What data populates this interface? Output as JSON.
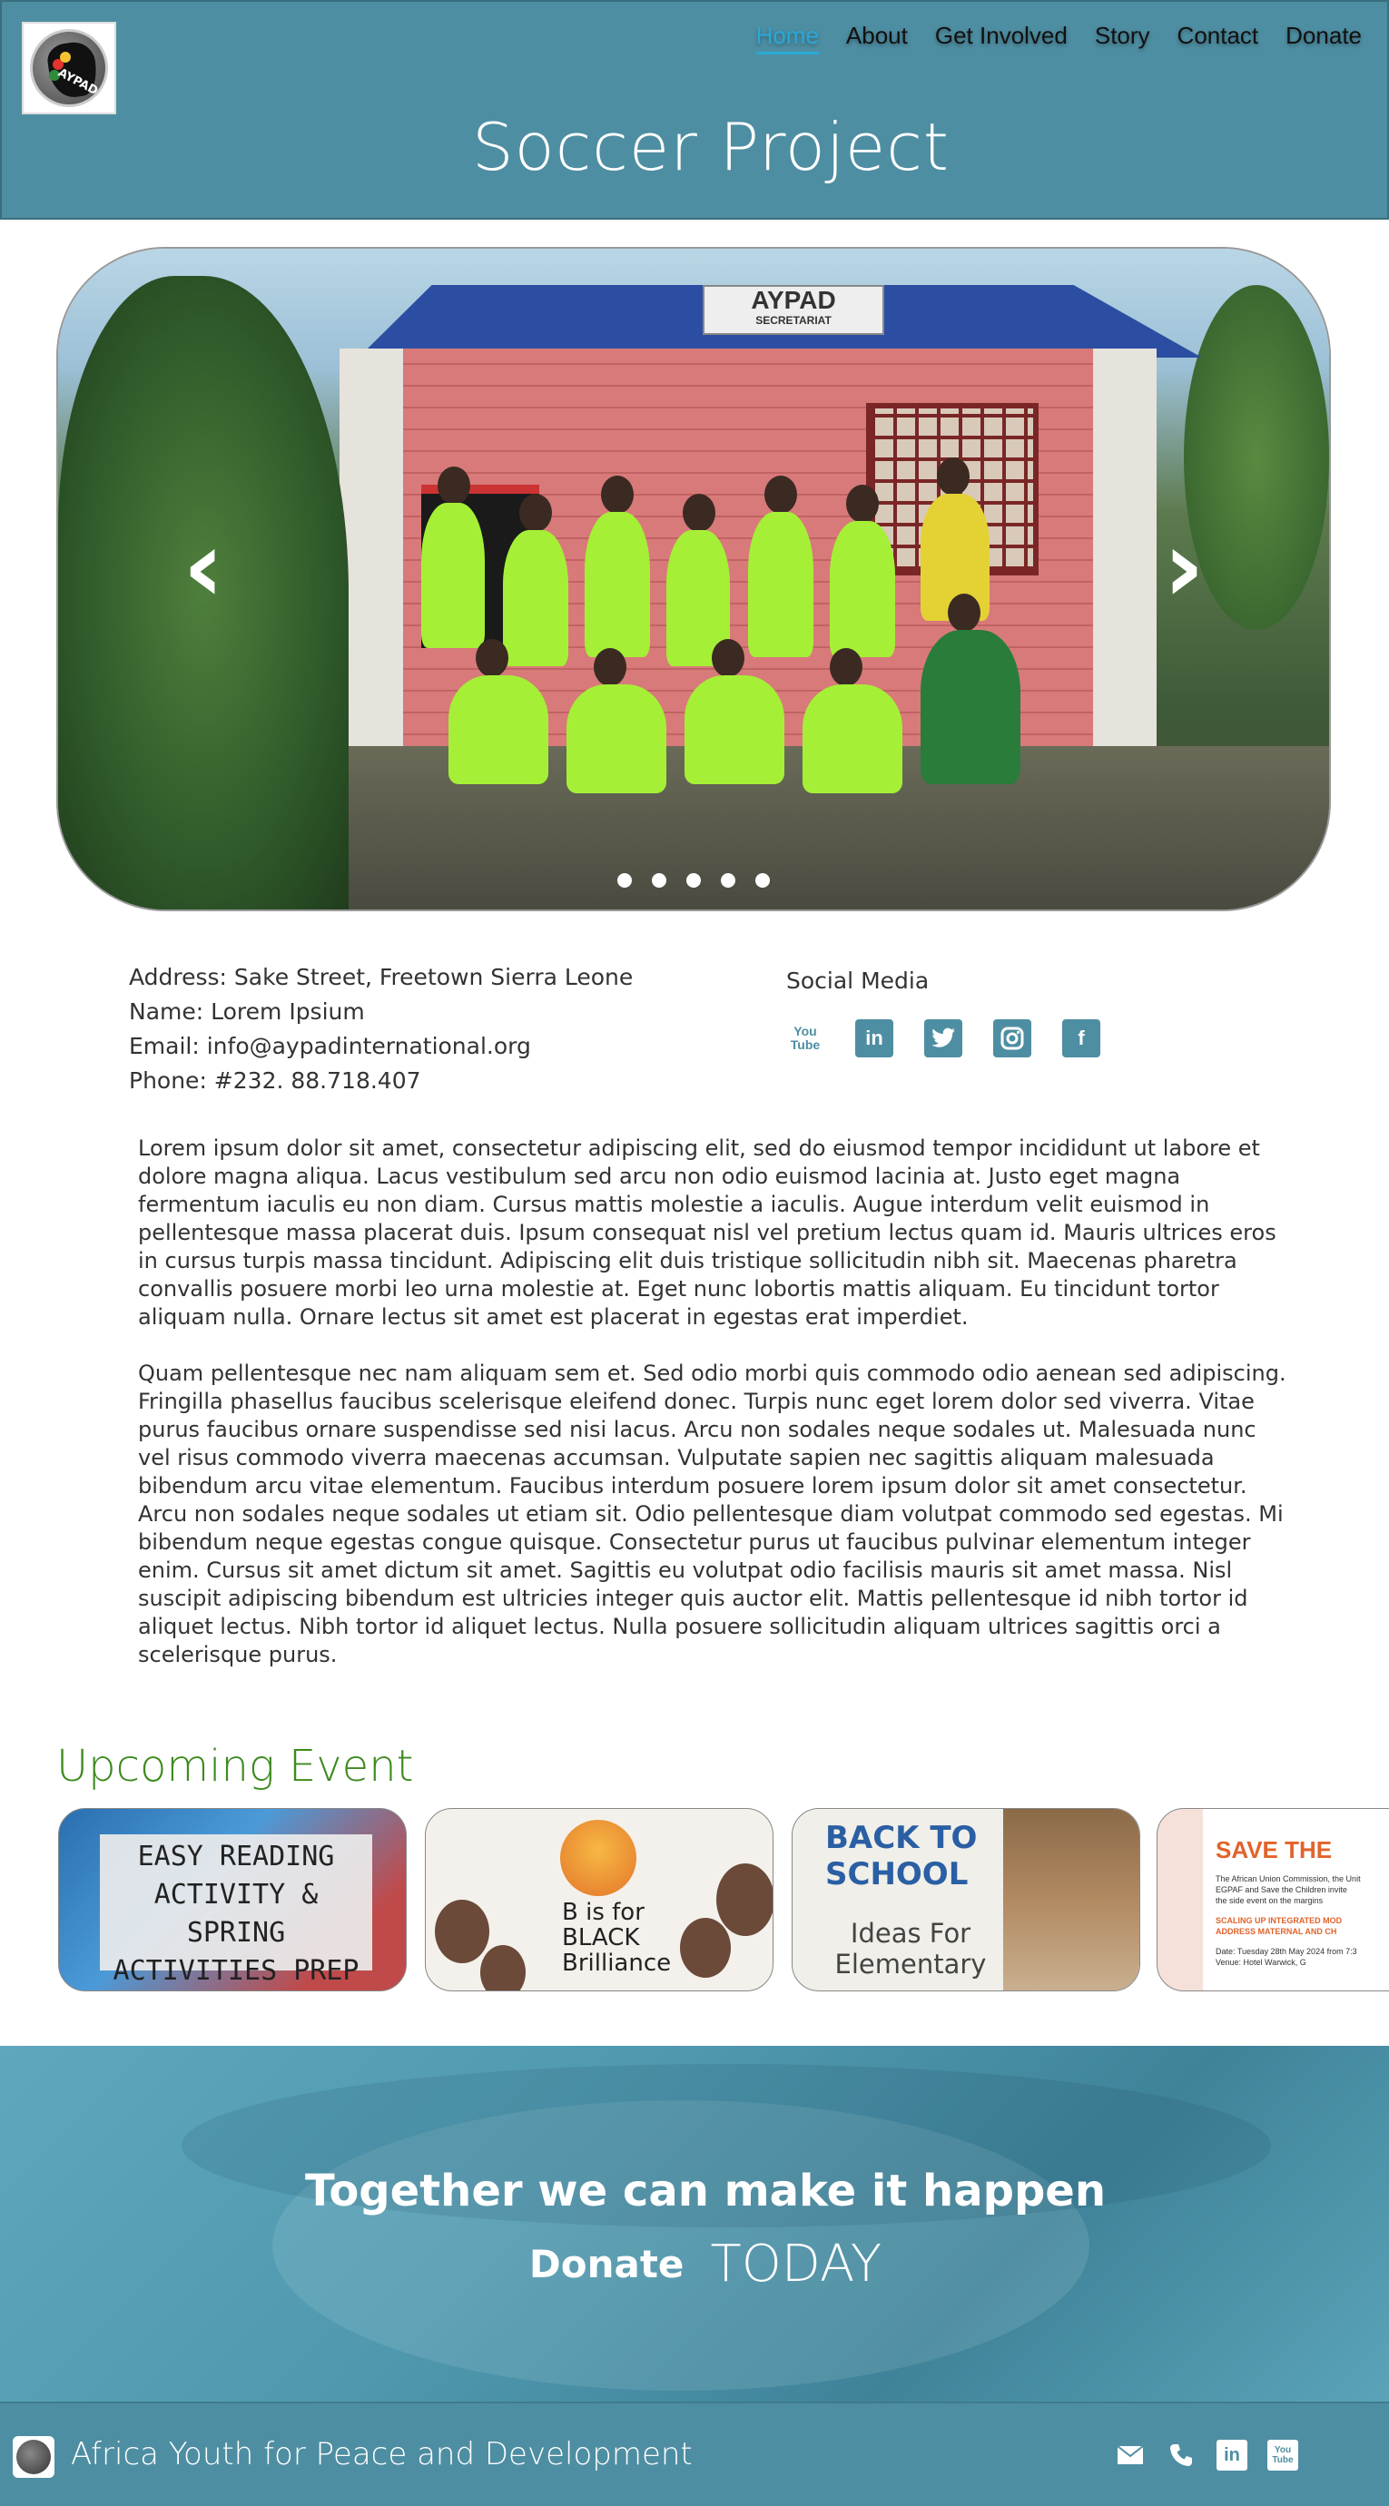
{
  "header": {
    "logo_text": "AYPAD",
    "nav": [
      {
        "label": "Home"
      },
      {
        "label": "About"
      },
      {
        "label": "Get Involved"
      },
      {
        "label": "Story"
      },
      {
        "label": "Contact"
      },
      {
        "label": "Donate"
      }
    ],
    "title": "Soccer Project"
  },
  "carousel": {
    "sign_text": "AYPAD",
    "sign_subtext": "SECRETARIAT",
    "slide_count": 5,
    "active_slide": 1
  },
  "contact": {
    "address": "Address: Sake Street, Freetown Sierra Leone",
    "name": "Name: Lorem Ipsium",
    "email": "Email: info@aypadinternational.org",
    "phone": "Phone: #232. 88.718.407"
  },
  "social": {
    "title": "Social Media",
    "icons": [
      "youtube-icon",
      "linkedin-icon",
      "twitter-icon",
      "instagram-icon",
      "facebook-icon"
    ]
  },
  "body": {
    "paragraph1": "Lorem ipsum dolor sit amet, consectetur adipiscing elit, sed do eiusmod tempor incididunt ut labore et dolore magna aliqua. Lacus vestibulum sed arcu non odio euismod lacinia at. Justo eget magna fermentum iaculis eu non diam. Cursus mattis molestie a iaculis. Augue interdum velit euismod in pellentesque massa placerat duis. Ipsum consequat nisl vel pretium lectus quam id. Mauris ultrices eros in cursus turpis massa tincidunt. Adipiscing elit duis tristique sollicitudin nibh sit. Maecenas pharetra convallis posuere morbi leo urna molestie at. Eget nunc lobortis mattis aliquam. Eu tincidunt tortor aliquam nulla. Ornare lectus sit amet est placerat in egestas erat imperdiet.",
    "paragraph2": "Quam pellentesque nec nam aliquam sem et. Sed odio morbi quis commodo odio aenean sed adipiscing. Fringilla phasellus faucibus scelerisque eleifend donec. Turpis nunc eget lorem dolor sed viverra. Vitae purus faucibus ornare suspendisse sed nisi lacus. Arcu non sodales neque sodales ut. Malesuada nunc vel risus commodo viverra maecenas accumsan. Vulputate sapien nec sagittis aliquam malesuada bibendum arcu vitae elementum. Faucibus interdum posuere lorem ipsum dolor sit amet consectetur. Arcu non sodales neque sodales ut etiam sit. Odio pellentesque diam volutpat commodo sed egestas. Mi bibendum neque egestas congue quisque. Consectetur purus ut faucibus pulvinar elementum integer enim. Cursus sit amet dictum sit amet. Sagittis eu volutpat odio facilisis mauris sit amet massa. Nisl suscipit adipiscing bibendum est ultricies integer quis auctor elit. Mattis pellentesque id nibh tortor id aliquet lectus. Nibh tortor id aliquet lectus. Nulla posuere sollicitudin aliquam ultrices sagittis orci a scelerisque purus."
  },
  "events": {
    "title": "Upcoming Event",
    "items": [
      {
        "lines": [
          "EASY READING",
          "ACTIVITY & SPRING",
          "ACTIVITIES PREP"
        ]
      },
      {
        "lines": [
          "B is for",
          "BLACK",
          "Brilliance"
        ]
      },
      {
        "title": "BACK TO SCHOOL",
        "subtitle": "Ideas For Elementary"
      },
      {
        "title": "SAVE THE",
        "line1": "The African Union Commission, the Unit",
        "line2": "EGPAF and Save the Children invite",
        "line3": "the side event on the margins",
        "line4": "SCALING UP INTEGRATED MOD",
        "line5": "ADDRESS MATERNAL AND CH",
        "line6": "Date: Tuesday 28th May 2024 from 7:3",
        "line7": "Venue: Hotel Warwick, G"
      }
    ]
  },
  "banner": {
    "line1": "Together we can make it happen",
    "donate": "Donate",
    "today": "TODAY"
  },
  "footer": {
    "title": "Africa Youth for Peace and Development",
    "icons": [
      "mail-icon",
      "phone-icon",
      "linkedin-icon",
      "youtube-icon"
    ]
  },
  "colors": {
    "brand": "#4e8ea2",
    "nav_active": "#2aa8d8",
    "event_title": "#3d8a1f"
  }
}
